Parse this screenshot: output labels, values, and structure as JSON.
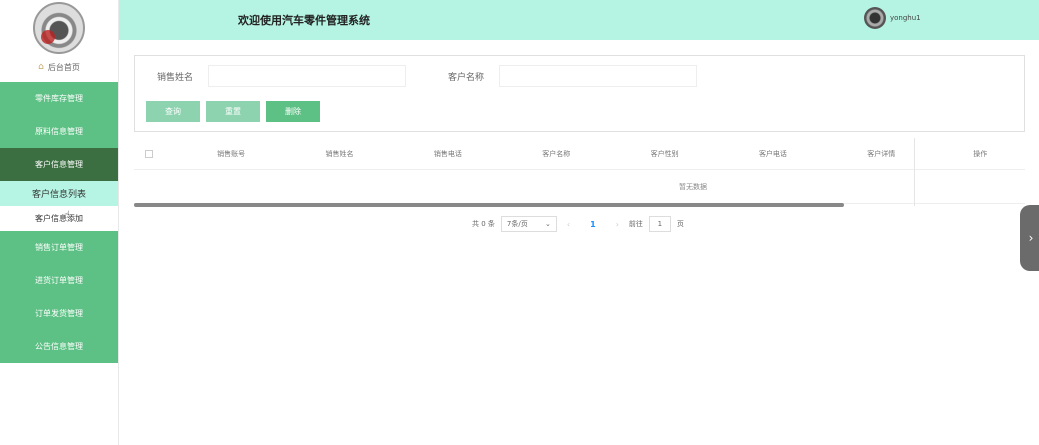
{
  "header": {
    "title": "欢迎使用汽车零件管理系统",
    "username": "yonghu1"
  },
  "sidebar": {
    "home_label": "后台首页",
    "items": [
      {
        "label": "零件库存管理"
      },
      {
        "label": "原料信息管理"
      },
      {
        "label": "客户信息管理"
      },
      {
        "label": "客户信息列表"
      },
      {
        "label": "客户信息添加"
      },
      {
        "label": "销售订单管理"
      },
      {
        "label": "进货订单管理"
      },
      {
        "label": "订单发货管理"
      },
      {
        "label": "公告信息管理"
      }
    ]
  },
  "search": {
    "sales_name_label": "销售姓名",
    "customer_name_label": "客户名称",
    "query_button": "查询",
    "reset_button": "重置",
    "delete_button": "删除"
  },
  "table": {
    "columns": [
      "销售账号",
      "销售姓名",
      "销售电话",
      "客户名称",
      "客户性别",
      "客户电话",
      "客户详情",
      "操作"
    ],
    "empty_text": "暂无数据"
  },
  "pagination": {
    "total_text": "共 0 条",
    "page_size": "7条/页",
    "current_page": "1",
    "goto_label": "前往",
    "goto_value": "1",
    "page_unit": "页"
  },
  "colors": {
    "header_bg": "#b5f4e2",
    "menu_bg": "#5dc084",
    "menu_active_bg": "#3b6e40",
    "submenu_selected_bg": "#b6f5e3"
  }
}
